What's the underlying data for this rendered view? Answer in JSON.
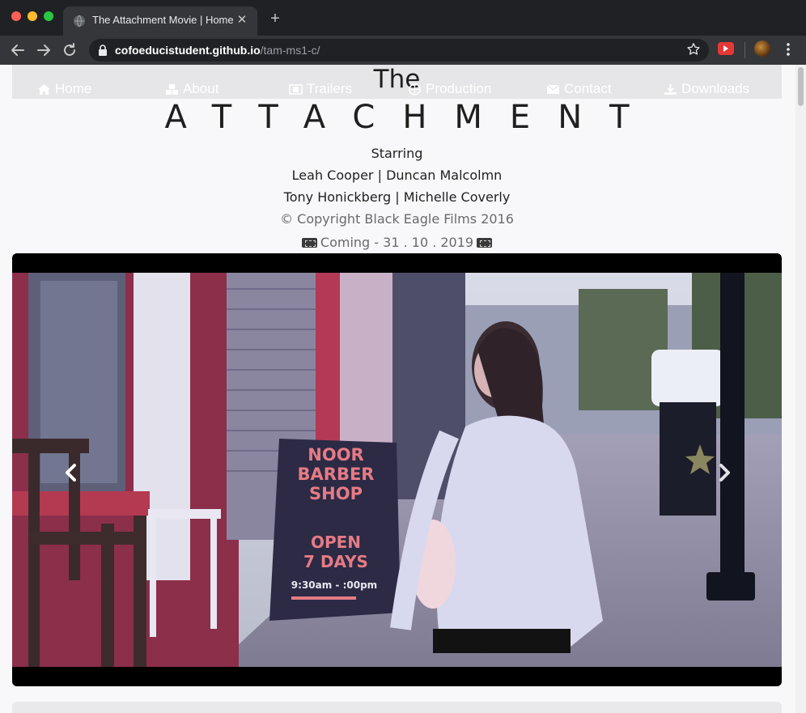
{
  "browser": {
    "tab_title": "The Attachment Movie | Homep",
    "url_host": "cofoeducistudent.github.io",
    "url_path": "/tam-ms1-c/"
  },
  "nav": {
    "items": [
      {
        "label": "Home",
        "icon": "home-icon"
      },
      {
        "label": "About",
        "icon": "cubes-icon"
      },
      {
        "label": "Trailers",
        "icon": "film-icon"
      },
      {
        "label": "Production",
        "icon": "globe-icon"
      },
      {
        "label": "Contact",
        "icon": "envelope-icon"
      },
      {
        "label": "Downloads",
        "icon": "download-icon"
      }
    ]
  },
  "hero": {
    "title_small": "The",
    "title_large": "ATTACHMENT",
    "starring_label": "Starring",
    "cast_line_1": "Leah Cooper | Duncan Malcolmn",
    "cast_line_2": "Tony Honickberg | Michelle Coverly",
    "copyright": "© Copyright Black Eagle Films 2016",
    "coming": "Coming - 31 . 10 . 2019"
  },
  "carousel": {
    "sign_line_1": "NOOR",
    "sign_line_2": "BARBER",
    "sign_line_3": "SHOP",
    "sign_line_4": "OPEN",
    "sign_line_5": "7 DAYS",
    "sign_line_6": "9:30am - :00pm"
  },
  "colors": {
    "navbar_bg": "#e6e6e8",
    "page_bg": "#f8f8fa",
    "text": "#1f1f1f"
  }
}
